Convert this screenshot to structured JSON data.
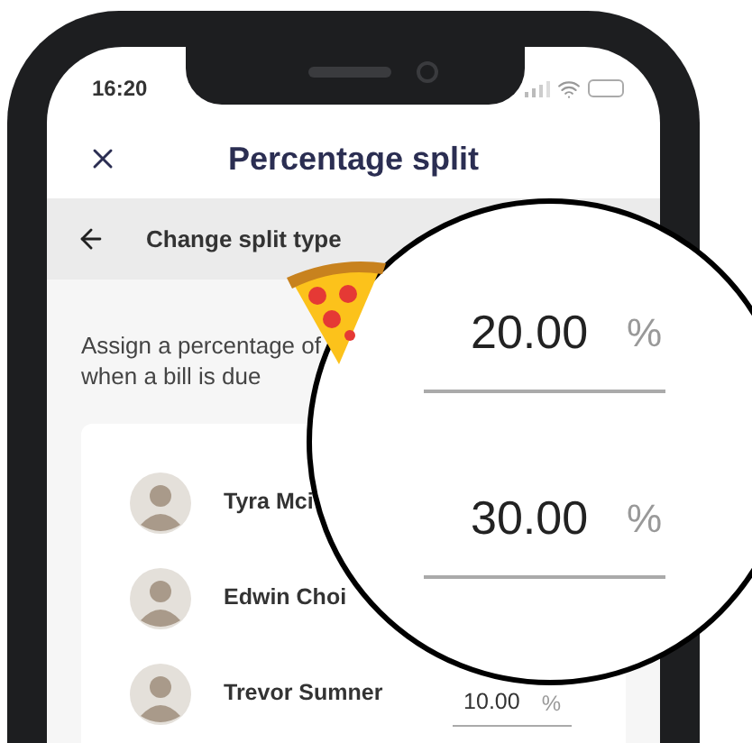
{
  "status_bar": {
    "time": "16:20"
  },
  "header": {
    "title": "Percentage split"
  },
  "sub_bar": {
    "label": "Change split type"
  },
  "description": [
    "Assign a percentage of",
    "when a bill is due"
  ],
  "members": [
    {
      "name": "Tyra Mci"
    },
    {
      "name": "Edwin Choi"
    },
    {
      "name": "Trevor Sumner",
      "value": "10.00",
      "unit": "%"
    }
  ],
  "magnifier": {
    "rows": [
      {
        "value": "20.00",
        "unit": "%"
      },
      {
        "value": "30.00",
        "unit": "%"
      }
    ]
  }
}
